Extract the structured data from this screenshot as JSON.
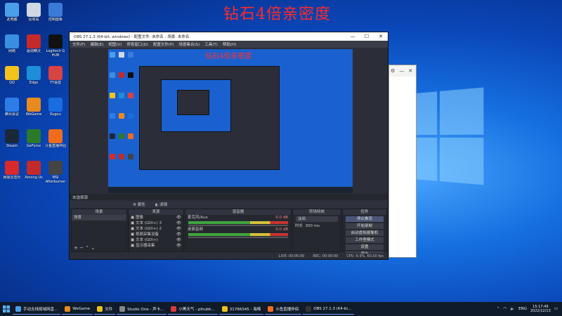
{
  "banner": "钻石4倍亲密度",
  "colors": {
    "banner": "#ff2a2a",
    "desktop_blue": "#0a46b8",
    "obs_bg": "#2b2e38",
    "accent": "#6aa6ff"
  },
  "desktop_icons": [
    {
      "label": "此电脑",
      "icon": "pc-icon",
      "color": "#4aa0e8"
    },
    {
      "label": "回收站",
      "icon": "recycle-bin-icon",
      "color": "#cfd8e3"
    },
    {
      "label": "控制面板",
      "icon": "control-panel-icon",
      "color": "#3b7bd8"
    },
    {
      "label": "网络",
      "icon": "network-icon",
      "color": "#3a8fe0"
    },
    {
      "label": "驱动精灵",
      "icon": "driver-icon",
      "color": "#c52a2a"
    },
    {
      "label": "Logitech G HUB",
      "icon": "logitech-icon",
      "color": "#111"
    },
    {
      "label": "QQ",
      "icon": "qq-icon",
      "color": "#f2c31b"
    },
    {
      "label": "Edge",
      "icon": "edge-icon",
      "color": "#1d8fd8"
    },
    {
      "label": "YY语音",
      "icon": "yy-icon",
      "color": "#d84343"
    },
    {
      "label": "腾讯会议",
      "icon": "meeting-icon",
      "color": "#2c7de8"
    },
    {
      "label": "WeGame",
      "icon": "wegame-icon",
      "color": "#e88b1e"
    },
    {
      "label": "Kugou",
      "icon": "kugou-icon",
      "color": "#1a6de0"
    },
    {
      "label": "Steam",
      "icon": "steam-icon",
      "color": "#1b2838"
    },
    {
      "label": "GeForce",
      "icon": "geforce-icon",
      "color": "#2a7a2a"
    },
    {
      "label": "斗鱼直播伴侣",
      "icon": "douyu-icon",
      "color": "#f06c1c"
    },
    {
      "label": "网易云音乐",
      "icon": "music-icon",
      "color": "#d82a2a"
    },
    {
      "label": "Among Us",
      "icon": "among-us-icon",
      "color": "#c32a2a"
    },
    {
      "label": "MSI Afterburner",
      "icon": "afterburner-icon",
      "color": "#444"
    }
  ],
  "obs": {
    "title": "OBS 27.1.3 (64-bit, windows) - 配置文件: 未命名 - 场景: 未命名",
    "menu": [
      "文件(F)",
      "编辑(E)",
      "视图(V)",
      "停靠窗口(D)",
      "配置文件(P)",
      "场景集合(S)",
      "工具(T)",
      "帮助(H)"
    ],
    "preview_title": "钻石4倍亲密度",
    "source_bar": "未选择源",
    "context": [
      "属性",
      "滤镜"
    ],
    "docks": {
      "scenes": {
        "header": "场景",
        "items": [
          "场景"
        ]
      },
      "sources": {
        "header": "来源",
        "items": [
          "图像",
          "文本 (GDI+) 3",
          "文本 (GDI+) 2",
          "视频采集设备",
          "文本 (GDI+)",
          "显示器采集"
        ]
      },
      "mixer": {
        "header": "混音器",
        "channels": [
          {
            "name": "麦克风/Aux",
            "db": "0.0 dB"
          },
          {
            "name": "桌面音频",
            "db": "0.0 dB"
          }
        ]
      },
      "transitions": {
        "header": "转场特效",
        "type": "淡出",
        "duration_label": "时长",
        "duration": "300 ms"
      },
      "controls": {
        "header": "控件",
        "buttons": [
          "停止推流",
          "开始录制",
          "启动虚拟摄像机",
          "工作室模式",
          "设置",
          "退出"
        ]
      }
    },
    "status": {
      "live": "LIVE: 00:00:00",
      "rec": "REC: 00:00:00",
      "cpu": "CPU: 6.9%, 60.00 fps"
    }
  },
  "taskbar": {
    "items": [
      {
        "label": "手动无线局域网直...",
        "icon": "network-icon",
        "color": "#4aa0e8"
      },
      {
        "label": "WeGame",
        "icon": "wegame-icon",
        "color": "#e88b1e"
      },
      {
        "label": "文件",
        "icon": "folder-icon",
        "color": "#e8c21e"
      },
      {
        "label": "Studio One - 声卡...",
        "icon": "studio-one-icon",
        "color": "#888"
      },
      {
        "label": "小黑天气 - plhubk...",
        "icon": "weather-icon",
        "color": "#d83a3a"
      },
      {
        "label": "31766345 - 海棉",
        "icon": "folder-icon",
        "color": "#e8c21e"
      },
      {
        "label": "斗鱼直播伴侣",
        "icon": "douyu-icon",
        "color": "#f06c1c"
      },
      {
        "label": "OBS 27.1.3 (64-bi...",
        "icon": "obs-icon",
        "color": "#333"
      }
    ],
    "lang": "ENG",
    "time": "15:17:49",
    "date": "2022/12/13"
  }
}
